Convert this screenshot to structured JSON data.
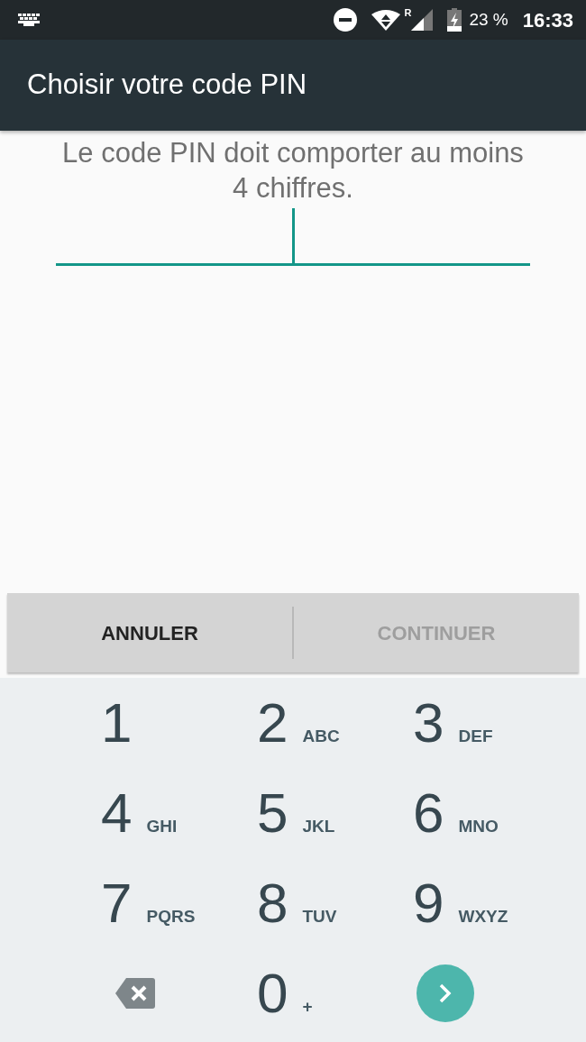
{
  "status_bar": {
    "roaming": "R",
    "battery": "23 %",
    "time": "16:33"
  },
  "app_bar": {
    "title": "Choisir votre code PIN"
  },
  "prompt": "Le code PIN doit comporter au moins 4 chiffres.",
  "buttons": [
    {
      "label": "ANNULER",
      "disabled": false
    },
    {
      "label": "CONTINUER",
      "disabled": true
    }
  ],
  "keypad": [
    {
      "kind": "digit",
      "digit": "1"
    },
    {
      "kind": "digit",
      "digit": "2",
      "letters": "ABC"
    },
    {
      "kind": "digit",
      "digit": "3",
      "letters": "DEF"
    },
    {
      "kind": "digit",
      "digit": "4",
      "letters": "GHI"
    },
    {
      "kind": "digit",
      "digit": "5",
      "letters": "JKL"
    },
    {
      "kind": "digit",
      "digit": "6",
      "letters": "MNO"
    },
    {
      "kind": "digit",
      "digit": "7",
      "letters": "PQRS"
    },
    {
      "kind": "digit",
      "digit": "8",
      "letters": "TUV"
    },
    {
      "kind": "digit",
      "digit": "9",
      "letters": "WXYZ"
    },
    {
      "kind": "delete"
    },
    {
      "kind": "digit",
      "digit": "0",
      "letters": "+"
    },
    {
      "kind": "enter"
    }
  ]
}
